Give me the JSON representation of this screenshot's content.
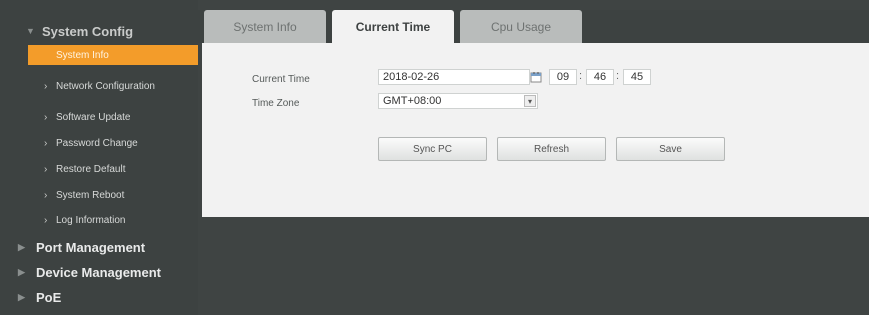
{
  "sidebar": {
    "system_config": "System Config",
    "items": [
      {
        "label": "System Info"
      },
      {
        "label": "Network Configuration"
      },
      {
        "label": "Software Update"
      },
      {
        "label": "Password Change"
      },
      {
        "label": "Restore Default"
      },
      {
        "label": "System Reboot"
      },
      {
        "label": "Log Information"
      }
    ],
    "port_management": "Port Management",
    "device_management": "Device Management",
    "poe": "PoE",
    "active_color": "#f39c2a"
  },
  "tabs": [
    {
      "label": "System Info"
    },
    {
      "label": "Current Time"
    },
    {
      "label": "Cpu Usage"
    }
  ],
  "time_form": {
    "current_time_label": "Current Time",
    "date": "2018-02-26",
    "hour": "09",
    "minute": "46",
    "second": "45",
    "colon": ":",
    "time_zone_label": "Time Zone",
    "time_zone": "GMT+08:00"
  },
  "buttons": {
    "sync": "Sync PC",
    "refresh": "Refresh",
    "save": "Save"
  }
}
